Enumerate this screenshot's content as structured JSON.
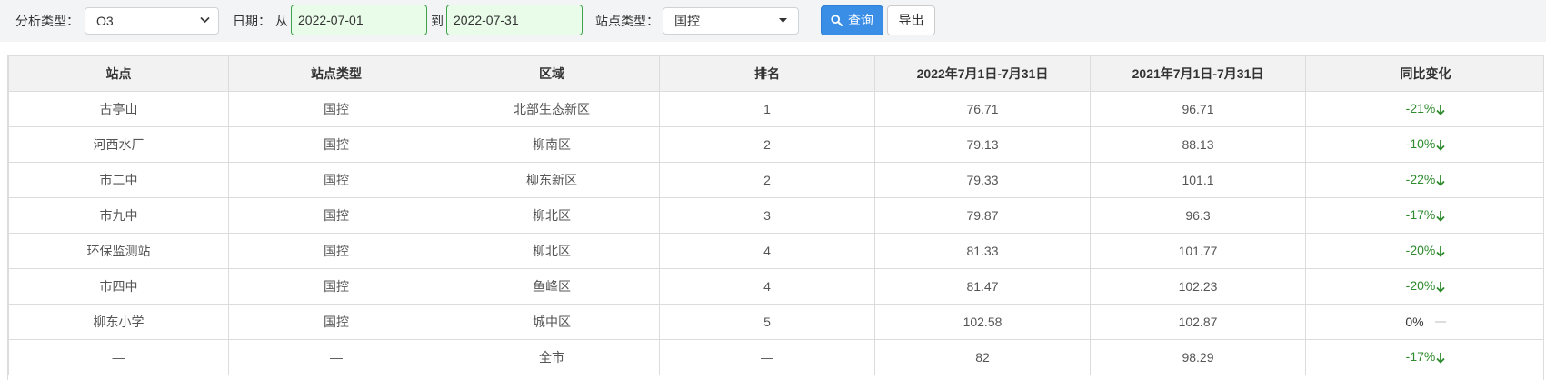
{
  "filters": {
    "analysis_type_label": "分析类型：",
    "analysis_type_value": "O3",
    "date_label": "日期：",
    "from_label": "从",
    "date_from": "2022-07-01",
    "to_label": "到",
    "date_to": "2022-07-31",
    "station_type_label": "站点类型：",
    "station_type_value": "国控",
    "query_label": "查询",
    "export_label": "导出"
  },
  "table": {
    "headers": [
      "站点",
      "站点类型",
      "区域",
      "排名",
      "2022年7月1日-7月31日",
      "2021年7月1日-7月31日",
      "同比变化"
    ],
    "rows": [
      {
        "station": "古亭山",
        "type": "国控",
        "region": "北部生态新区",
        "rank": "1",
        "v2022": "76.71",
        "v2021": "96.71",
        "change": "-21%",
        "trend": "down"
      },
      {
        "station": "河西水厂",
        "type": "国控",
        "region": "柳南区",
        "rank": "2",
        "v2022": "79.13",
        "v2021": "88.13",
        "change": "-10%",
        "trend": "down"
      },
      {
        "station": "市二中",
        "type": "国控",
        "region": "柳东新区",
        "rank": "2",
        "v2022": "79.33",
        "v2021": "101.1",
        "change": "-22%",
        "trend": "down"
      },
      {
        "station": "市九中",
        "type": "国控",
        "region": "柳北区",
        "rank": "3",
        "v2022": "79.87",
        "v2021": "96.3",
        "change": "-17%",
        "trend": "down"
      },
      {
        "station": "环保监测站",
        "type": "国控",
        "region": "柳北区",
        "rank": "4",
        "v2022": "81.33",
        "v2021": "101.77",
        "change": "-20%",
        "trend": "down"
      },
      {
        "station": "市四中",
        "type": "国控",
        "region": "鱼峰区",
        "rank": "4",
        "v2022": "81.47",
        "v2021": "102.23",
        "change": "-20%",
        "trend": "down"
      },
      {
        "station": "柳东小学",
        "type": "国控",
        "region": "城中区",
        "rank": "5",
        "v2022": "102.58",
        "v2021": "102.87",
        "change": "0%",
        "trend": "flat"
      },
      {
        "station": "—",
        "type": "—",
        "region": "全市",
        "rank": "—",
        "v2022": "82",
        "v2021": "98.29",
        "change": "-17%",
        "trend": "down"
      }
    ]
  },
  "colors": {
    "trend_down": "#2e8b2e",
    "primary": "#3a8ee6",
    "date_border": "#3fa34d",
    "date_bg": "#e9fbe9"
  }
}
